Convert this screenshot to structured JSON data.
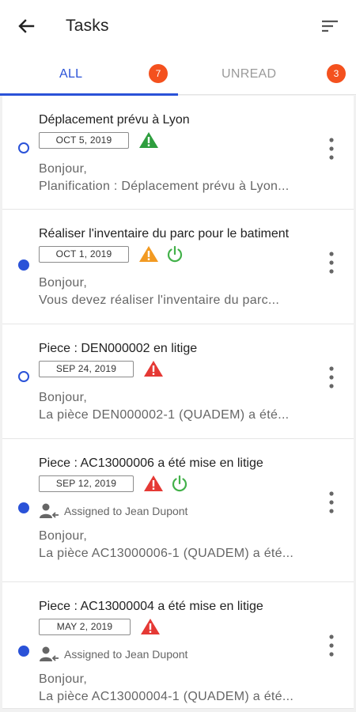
{
  "appbar": {
    "title": "Tasks"
  },
  "tabs": {
    "all": {
      "label": "ALL",
      "count": "7",
      "badge_color": "#f4511e"
    },
    "unread": {
      "label": "UNREAD",
      "count": "3",
      "badge_color": "#f4511e"
    }
  },
  "accent": "#2a52d8",
  "tasks": [
    {
      "title": "Déplacement prévu à Lyon",
      "date": "OCT 5, 2019",
      "read": false,
      "warning": "green",
      "power": false,
      "assignee": "",
      "body1": "Bonjour,",
      "body2": "Planification : Déplacement prévu à Lyon..."
    },
    {
      "title": "Réaliser l'inventaire du parc pour le batiment",
      "date": "OCT 1, 2019",
      "read": true,
      "warning": "orange",
      "power": true,
      "assignee": "",
      "body1": "Bonjour,",
      "body2": "Vous devez réaliser l'inventaire du parc..."
    },
    {
      "title": "Piece : DEN000002 en litige",
      "date": "SEP 24, 2019",
      "read": false,
      "warning": "red",
      "power": false,
      "assignee": "",
      "body1": "Bonjour,",
      "body2": "La pièce DEN000002-1 (QUADEM) a été..."
    },
    {
      "title": "Piece : AC13000006 a été mise en litige",
      "date": "SEP 12, 2019",
      "read": true,
      "warning": "red",
      "power": true,
      "assignee": "Assigned to Jean Dupont",
      "body1": "Bonjour,",
      "body2": "La pièce AC13000006-1 (QUADEM) a été..."
    },
    {
      "title": "Piece : AC13000004 a été mise en litige",
      "date": "MAY 2, 2019",
      "read": true,
      "warning": "red",
      "power": false,
      "assignee": "Assigned to Jean Dupont",
      "body1": "Bonjour,",
      "body2": "La pièce AC13000004-1 (QUADEM) a été..."
    }
  ],
  "icons": {
    "back": "arrow-left-icon",
    "sort": "sort-icon",
    "warning": "warning-triangle-icon",
    "power": "power-icon",
    "assignee": "assigned-user-icon",
    "more": "more-vertical-icon"
  },
  "colors": {
    "warning_green": "#2e9e3e",
    "warning_orange": "#f29a22",
    "warning_red": "#e53935",
    "power_green": "#43b14a"
  }
}
